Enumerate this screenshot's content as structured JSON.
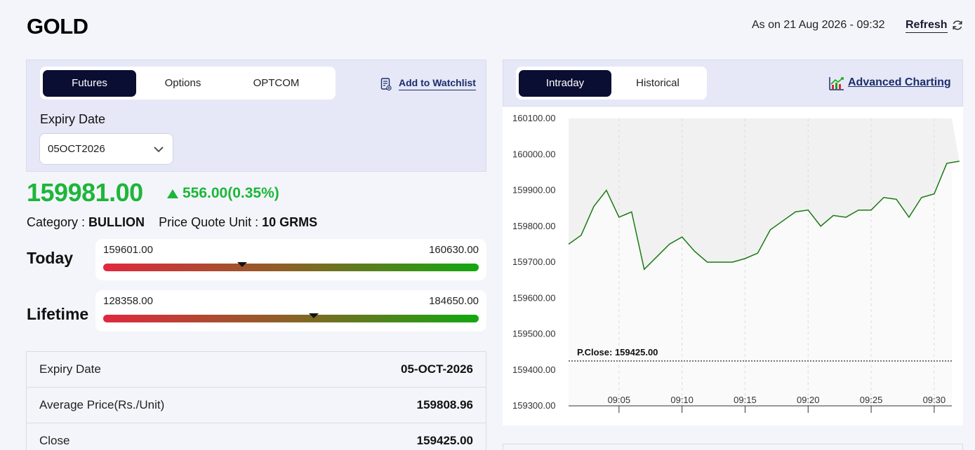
{
  "header": {
    "title": "GOLD",
    "as_on": "As on 21 Aug 2026 - 09:32",
    "refresh_label": "Refresh"
  },
  "left": {
    "tabs": [
      {
        "label": "Futures",
        "active": true
      },
      {
        "label": "Options",
        "active": false
      },
      {
        "label": "OPTCOM",
        "active": false
      }
    ],
    "watchlist_label": "Add to Watchlist",
    "expiry_label": "Expiry Date",
    "expiry_value": "05OCT2026",
    "price": "159981.00",
    "change": "556.00(0.35%)",
    "category_key": "Category : ",
    "category_value": "BULLION",
    "pqu_key": "Price Quote Unit : ",
    "pqu_value": "10 GRMS",
    "today": {
      "label": "Today",
      "low": "159601.00",
      "high": "160630.00",
      "marker_fraction": 0.37
    },
    "lifetime": {
      "label": "Lifetime",
      "low": "128358.00",
      "high": "184650.00",
      "marker_fraction": 0.56
    },
    "info_rows": [
      {
        "key": "Expiry Date",
        "value": "05-OCT-2026"
      },
      {
        "key": "Average Price(Rs./Unit)",
        "value": "159808.96"
      },
      {
        "key": "Close",
        "value": "159425.00"
      }
    ]
  },
  "right": {
    "tabs": [
      {
        "label": "Intraday",
        "active": true
      },
      {
        "label": "Historical",
        "active": false
      }
    ],
    "advanced_label": "Advanced Charting"
  },
  "colors": {
    "accent_dark": "#0b0e33",
    "up_green": "#1db63a",
    "line_green": "#1a7a12",
    "link_blue": "#1b2d6b"
  },
  "chart_data": {
    "type": "line",
    "y_ticks": [
      "160100.00",
      "160000.00",
      "159900.00",
      "159800.00",
      "159700.00",
      "159600.00",
      "159500.00",
      "159400.00",
      "159300.00"
    ],
    "ylim": [
      159300,
      160100
    ],
    "x_ticks": [
      "09:05",
      "09:10",
      "09:15",
      "09:20",
      "09:25",
      "09:30"
    ],
    "x_tick_minutes": [
      5,
      10,
      15,
      20,
      25,
      30
    ],
    "xlim": [
      1,
      31.4
    ],
    "reference_line": {
      "label": "P.Close: 159425.00",
      "value": 159425
    },
    "series": [
      {
        "x": [
          1,
          2,
          3,
          4,
          5,
          6,
          7,
          8,
          9,
          10,
          11,
          12,
          13,
          14,
          15,
          16,
          17,
          18,
          19,
          20,
          21,
          22,
          23,
          24,
          25,
          26,
          27,
          28,
          29,
          30,
          31,
          32
        ],
        "values": [
          159750,
          159775,
          159855,
          159900,
          159825,
          159840,
          159680,
          159715,
          159750,
          159770,
          159730,
          159700,
          159700,
          159700,
          159710,
          159725,
          159790,
          159815,
          159840,
          159845,
          159800,
          159830,
          159825,
          159845,
          159845,
          159880,
          159875,
          159825,
          159880,
          159890,
          159975,
          159981
        ]
      }
    ]
  }
}
